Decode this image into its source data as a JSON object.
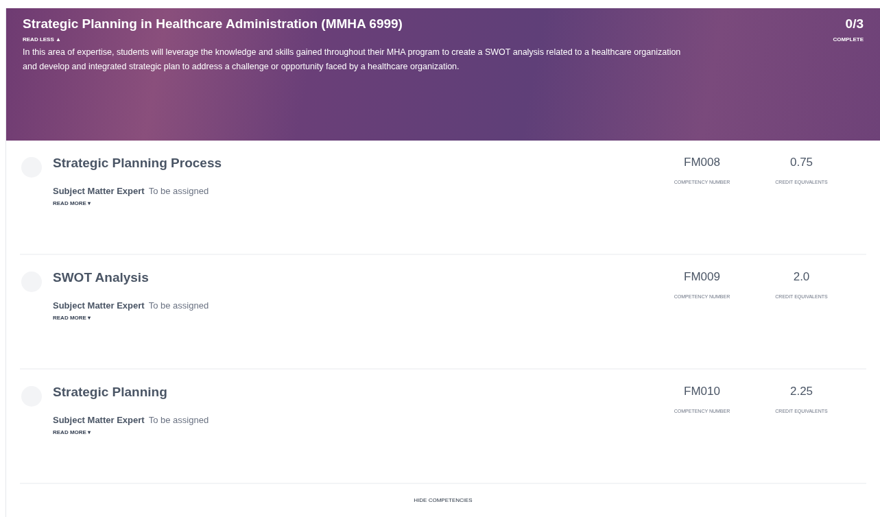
{
  "header": {
    "title": "Strategic Planning in Healthcare Administration (MMHA 6999)",
    "toggle": "READ LESS ▲",
    "description": "In this area of expertise, students will leverage the knowledge and skills gained throughout their MHA program to create a SWOT analysis related to a healthcare organization and develop and integrated strategic plan to address a challenge or opportunity faced by a healthcare organization.",
    "progress": "0/3",
    "progress_label": "COMPLETE"
  },
  "competencies": [
    {
      "title": "Strategic Planning Process",
      "expert_label": "Subject Matter Expert",
      "expert": "To be assigned",
      "toggle": "READ MORE ▾",
      "number": "FM008",
      "number_label": "COMPETENCY NUMBER",
      "credits": "0.75",
      "credits_label": "CREDIT EQUIVALENTS",
      "completed": false
    },
    {
      "title": "SWOT Analysis",
      "expert_label": "Subject Matter Expert",
      "expert": "To be assigned",
      "toggle": "READ MORE ▾",
      "number": "FM009",
      "number_label": "COMPETENCY NUMBER",
      "credits": "2.0",
      "credits_label": "CREDIT EQUIVALENTS",
      "completed": false
    },
    {
      "title": "Strategic Planning",
      "expert_label": "Subject Matter Expert",
      "expert": "To be assigned",
      "toggle": "READ MORE ▾",
      "number": "FM010",
      "number_label": "COMPETENCY NUMBER",
      "credits": "2.25",
      "credits_label": "CREDIT EQUIVALENTS",
      "completed": false
    }
  ],
  "footer": {
    "toggle": "HIDE COMPETENCIES"
  }
}
